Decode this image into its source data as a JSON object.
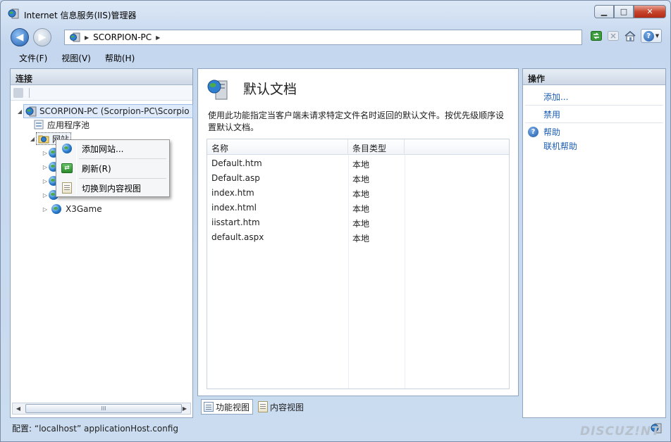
{
  "window": {
    "title": "Internet 信息服务(IIS)管理器",
    "minimize": "▁",
    "maximize": "□",
    "close": "✕"
  },
  "address": {
    "path": "SCORPION-PC",
    "arrow": "▶"
  },
  "menu": {
    "items": [
      "文件(F)",
      "视图(V)",
      "帮助(H)"
    ]
  },
  "connections": {
    "header": "连接",
    "tree": {
      "server": "SCORPION-PC (Scorpion-PC\\Scorpio",
      "app_pools": "应用程序池",
      "sites": "网站",
      "x3game": "X3Game"
    },
    "scroll_grip": "III"
  },
  "context_menu": {
    "items": [
      "添加网站...",
      "刷新(R)",
      "切换到内容视图"
    ]
  },
  "feature": {
    "title": "默认文档",
    "description": "使用此功能指定当客户端未请求特定文件名时返回的默认文件。按优先级顺序设置默认文档。",
    "columns": [
      "名称",
      "条目类型"
    ],
    "rows": [
      {
        "name": "Default.htm",
        "type": "本地"
      },
      {
        "name": "Default.asp",
        "type": "本地"
      },
      {
        "name": "index.htm",
        "type": "本地"
      },
      {
        "name": "index.html",
        "type": "本地"
      },
      {
        "name": "iisstart.htm",
        "type": "本地"
      },
      {
        "name": "default.aspx",
        "type": "本地"
      }
    ]
  },
  "view_tabs": {
    "features": "功能视图",
    "content": "内容视图"
  },
  "actions": {
    "header": "操作",
    "add": "添加...",
    "disable": "禁用",
    "help": "帮助",
    "online_help": "联机帮助"
  },
  "status": {
    "text": "配置: “localhost” applicationHost.config"
  },
  "watermark": "DISCUZ!NT"
}
